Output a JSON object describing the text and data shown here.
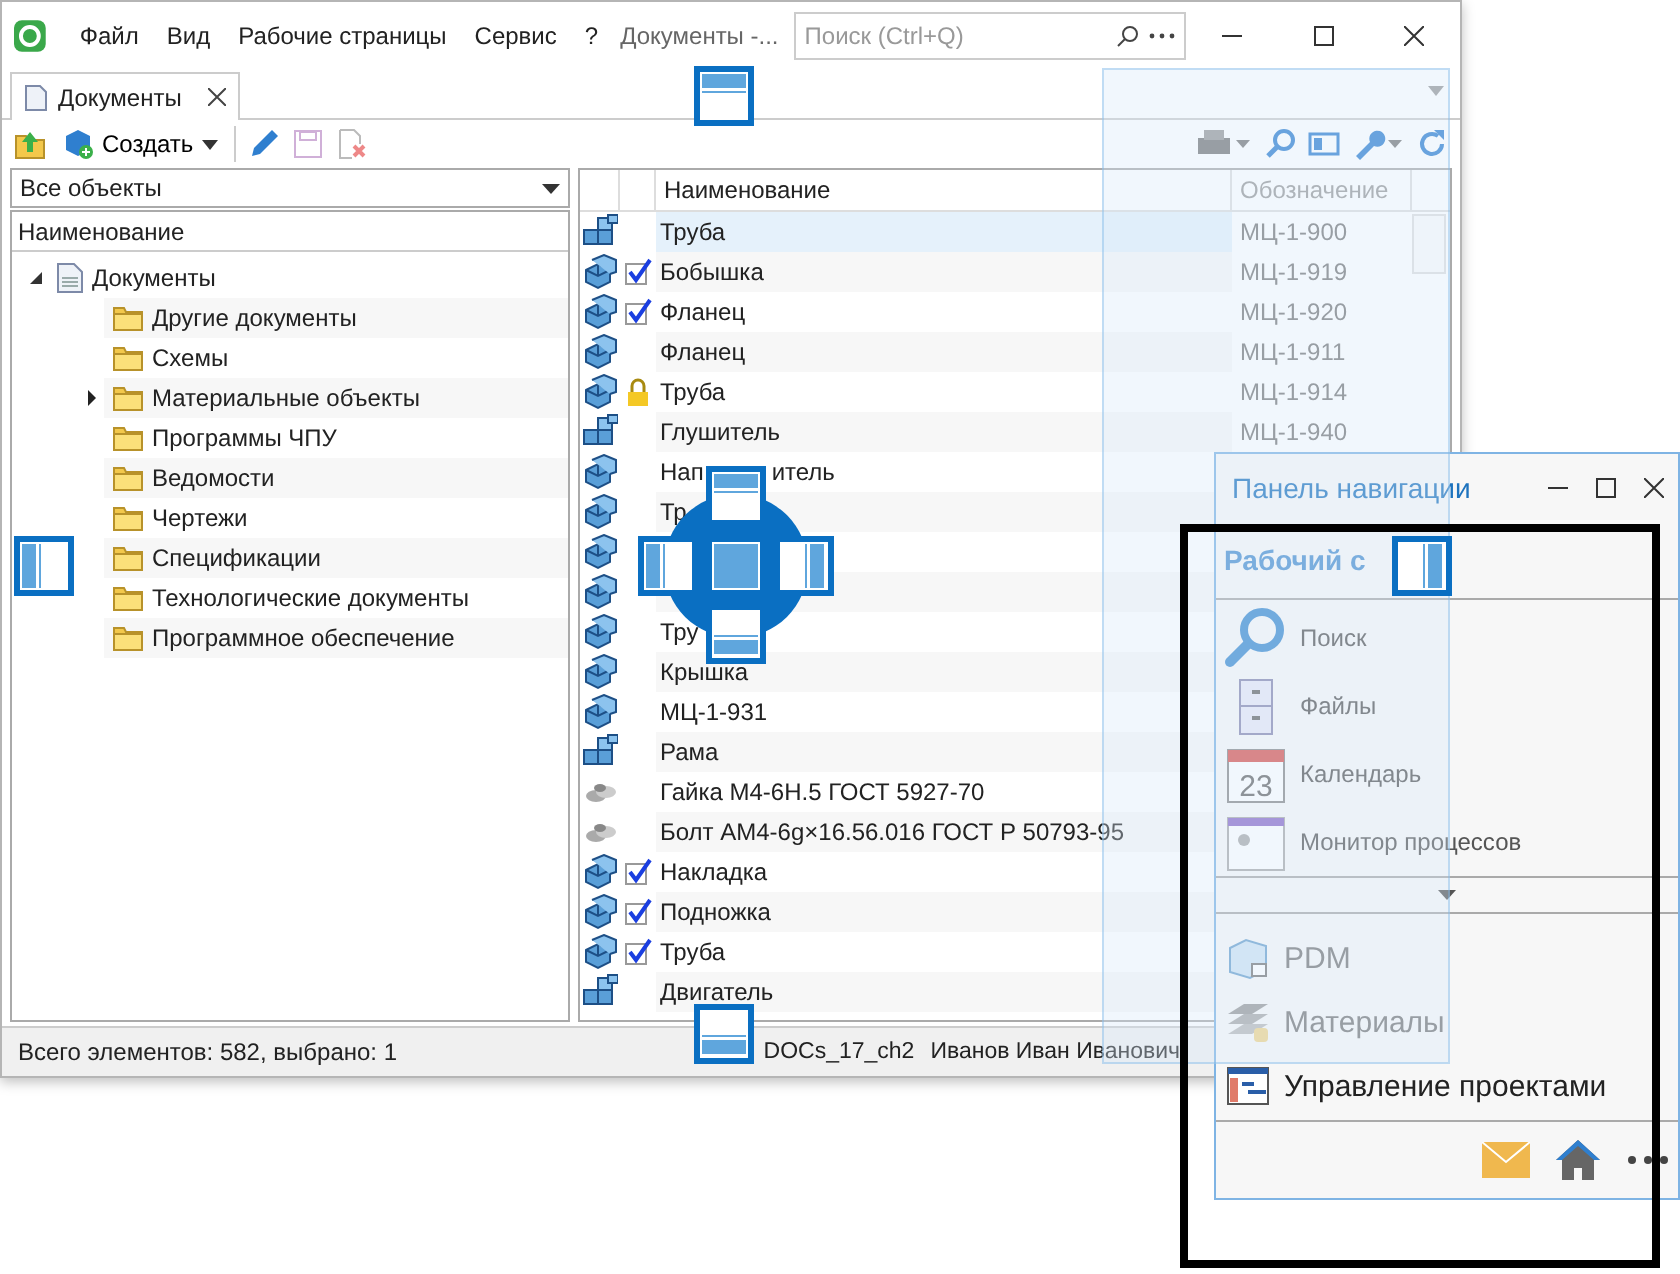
{
  "window": {
    "menu": [
      "Файл",
      "Вид",
      "Рабочие страницы",
      "Сервис",
      "?"
    ],
    "title": "Документы -...",
    "search": {
      "placeholder": "Поиск (Ctrl+Q)"
    }
  },
  "tabs": [
    {
      "label": "Документы",
      "selected": true
    }
  ],
  "toolbar": {
    "create": "Создать"
  },
  "filter": {
    "value": "Все объекты"
  },
  "tree": {
    "column": "Наименование",
    "items": [
      {
        "label": "Документы",
        "expanded": true,
        "children": [
          {
            "label": "Другие документы"
          },
          {
            "label": "Схемы"
          },
          {
            "label": "Материальные объекты",
            "expanded": false
          },
          {
            "label": "Программы ЧПУ"
          },
          {
            "label": "Ведомости"
          },
          {
            "label": "Чертежи"
          },
          {
            "label": "Спецификации"
          },
          {
            "label": "Технологические документы"
          },
          {
            "label": "Программное обеспечение"
          }
        ]
      }
    ]
  },
  "table": {
    "columns": [
      "Наименование",
      "Обозначение"
    ],
    "rows": [
      {
        "kind": "assembly",
        "checked": false,
        "locked": false,
        "selected": true,
        "name": "Труба",
        "code": "МЦ-1-900"
      },
      {
        "kind": "part",
        "checked": true,
        "locked": false,
        "selected": false,
        "name": "Бобышка",
        "code": "МЦ-1-919"
      },
      {
        "kind": "part",
        "checked": true,
        "locked": false,
        "selected": false,
        "name": "Фланец",
        "code": "МЦ-1-920"
      },
      {
        "kind": "part",
        "checked": false,
        "locked": false,
        "selected": false,
        "name": "Фланец",
        "code": "МЦ-1-911"
      },
      {
        "kind": "part",
        "checked": false,
        "locked": true,
        "selected": false,
        "name": "Труба",
        "code": "МЦ-1-914"
      },
      {
        "kind": "assembly",
        "checked": false,
        "locked": false,
        "selected": false,
        "name": "Глушитель",
        "code": "МЦ-1-940"
      },
      {
        "kind": "part",
        "checked": false,
        "locked": false,
        "selected": false,
        "name": "Нап",
        "name_end": "итель"
      },
      {
        "kind": "part",
        "checked": false,
        "locked": false,
        "selected": false,
        "name": "Тр"
      },
      {
        "kind": "part",
        "checked": false,
        "locked": false,
        "selected": false
      },
      {
        "kind": "part",
        "checked": false,
        "locked": false,
        "selected": false
      },
      {
        "kind": "part",
        "checked": false,
        "locked": false,
        "selected": false,
        "name": "Тру"
      },
      {
        "kind": "part",
        "checked": false,
        "locked": false,
        "selected": false,
        "name": "Крышка"
      },
      {
        "kind": "part",
        "checked": false,
        "locked": false,
        "selected": false,
        "name": "МЦ-1-931"
      },
      {
        "kind": "assembly",
        "checked": false,
        "locked": false,
        "selected": false,
        "name": "Рама"
      },
      {
        "kind": "standard",
        "checked": false,
        "locked": false,
        "selected": false,
        "name": "Гайка М4-6Н.5 ГОСТ 5927-70"
      },
      {
        "kind": "standard",
        "checked": false,
        "locked": false,
        "selected": false,
        "name": "Болт АМ4-6g×16.56.016 ГОСТ Р 50793-95"
      },
      {
        "kind": "part",
        "checked": true,
        "locked": false,
        "selected": false,
        "name": "Накладка"
      },
      {
        "kind": "part",
        "checked": true,
        "locked": false,
        "selected": false,
        "name": "Подножка"
      },
      {
        "kind": "part",
        "checked": true,
        "locked": false,
        "selected": false,
        "name": "Труба"
      },
      {
        "kind": "assembly",
        "checked": false,
        "locked": false,
        "selected": false,
        "name": "Двигатель"
      }
    ]
  },
  "status_bar": {
    "count": "Всего элементов: 582, выбрано: 1",
    "database": "DOCs_17_ch2",
    "user": "Иванов Иван Иванович"
  },
  "nav_panel": {
    "title": "Панель навигации",
    "section": "Рабочий с",
    "items": [
      {
        "kind": "search",
        "label": "Поиск"
      },
      {
        "kind": "files",
        "label": "Файлы"
      },
      {
        "kind": "calendar",
        "label": "Календарь",
        "day": "23"
      },
      {
        "kind": "monitor",
        "label": "Монитор процессов"
      }
    ],
    "modules": [
      {
        "kind": "pdm",
        "label": "PDM",
        "selected": false
      },
      {
        "kind": "materials",
        "label": "Материалы",
        "selected": false
      },
      {
        "kind": "projects",
        "label": "Управление проектами",
        "selected": true
      }
    ]
  }
}
